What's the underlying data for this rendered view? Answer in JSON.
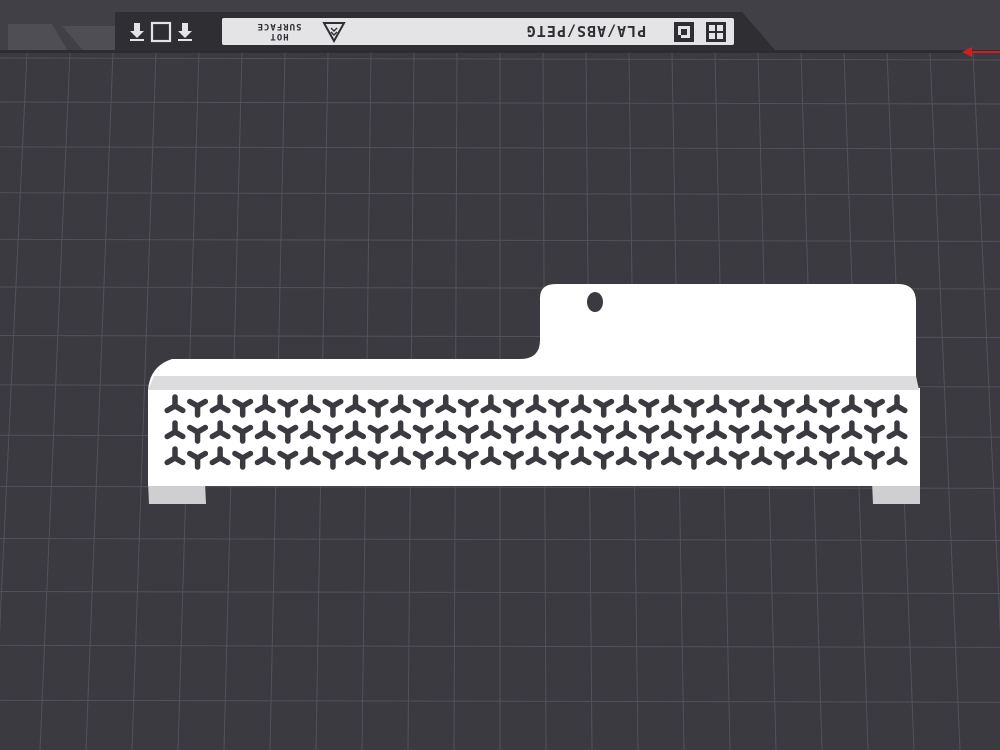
{
  "bed": {
    "material_label": "PLA/ABS/PETG",
    "hot_surface_line1": "HOT",
    "hot_surface_line2": "SURFACE",
    "icons": [
      "arrow-down-icon",
      "square-outline-icon",
      "arrow-down-icon",
      "warning-triangle-icon",
      "qr-code-icon",
      "grid-logo-icon"
    ]
  },
  "axis": {
    "x_indicator_color": "#d21d1d"
  },
  "colors": {
    "background": "#3a3a40",
    "grid_line": "#52525a",
    "model_face": "#ffffff",
    "model_shade": "#d8d8d8",
    "hole_fill": "#3a3a40"
  },
  "model": {
    "pattern": "trefoil-vents",
    "vent_rows": 3,
    "vents_per_row": 33,
    "mount_holes": 1
  }
}
